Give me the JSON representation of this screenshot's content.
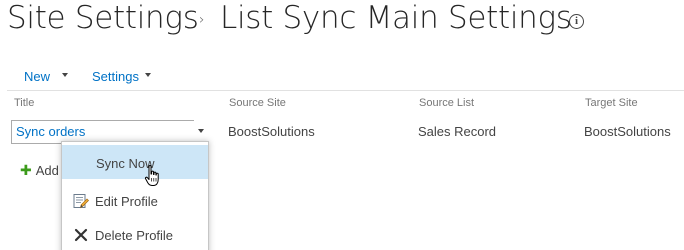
{
  "breadcrumb": {
    "root": "Site Settings",
    "separator": "›",
    "current": "List Sync Main Settings",
    "info_glyph": "i"
  },
  "toolbar": {
    "new_label": "New",
    "settings_label": "Settings"
  },
  "table": {
    "columns": [
      "Title",
      "Source Site",
      "Source List",
      "Target Site"
    ],
    "rows": [
      {
        "title": "Sync orders",
        "source_site": "BoostSolutions",
        "source_list": "Sales Record",
        "target_site": "BoostSolutions"
      }
    ],
    "add_label": "Add n"
  },
  "context_menu": {
    "items": [
      {
        "label": "Sync Now",
        "icon": "none",
        "highlighted": true
      },
      {
        "label": "Edit Profile",
        "icon": "edit-profile-icon"
      },
      {
        "label": "Delete Profile",
        "icon": "delete-x-icon"
      }
    ]
  },
  "colors": {
    "link": "#0072c6",
    "highlight": "#cde6f7",
    "add_plus": "#3c9b1b",
    "title_text": "#262626"
  }
}
